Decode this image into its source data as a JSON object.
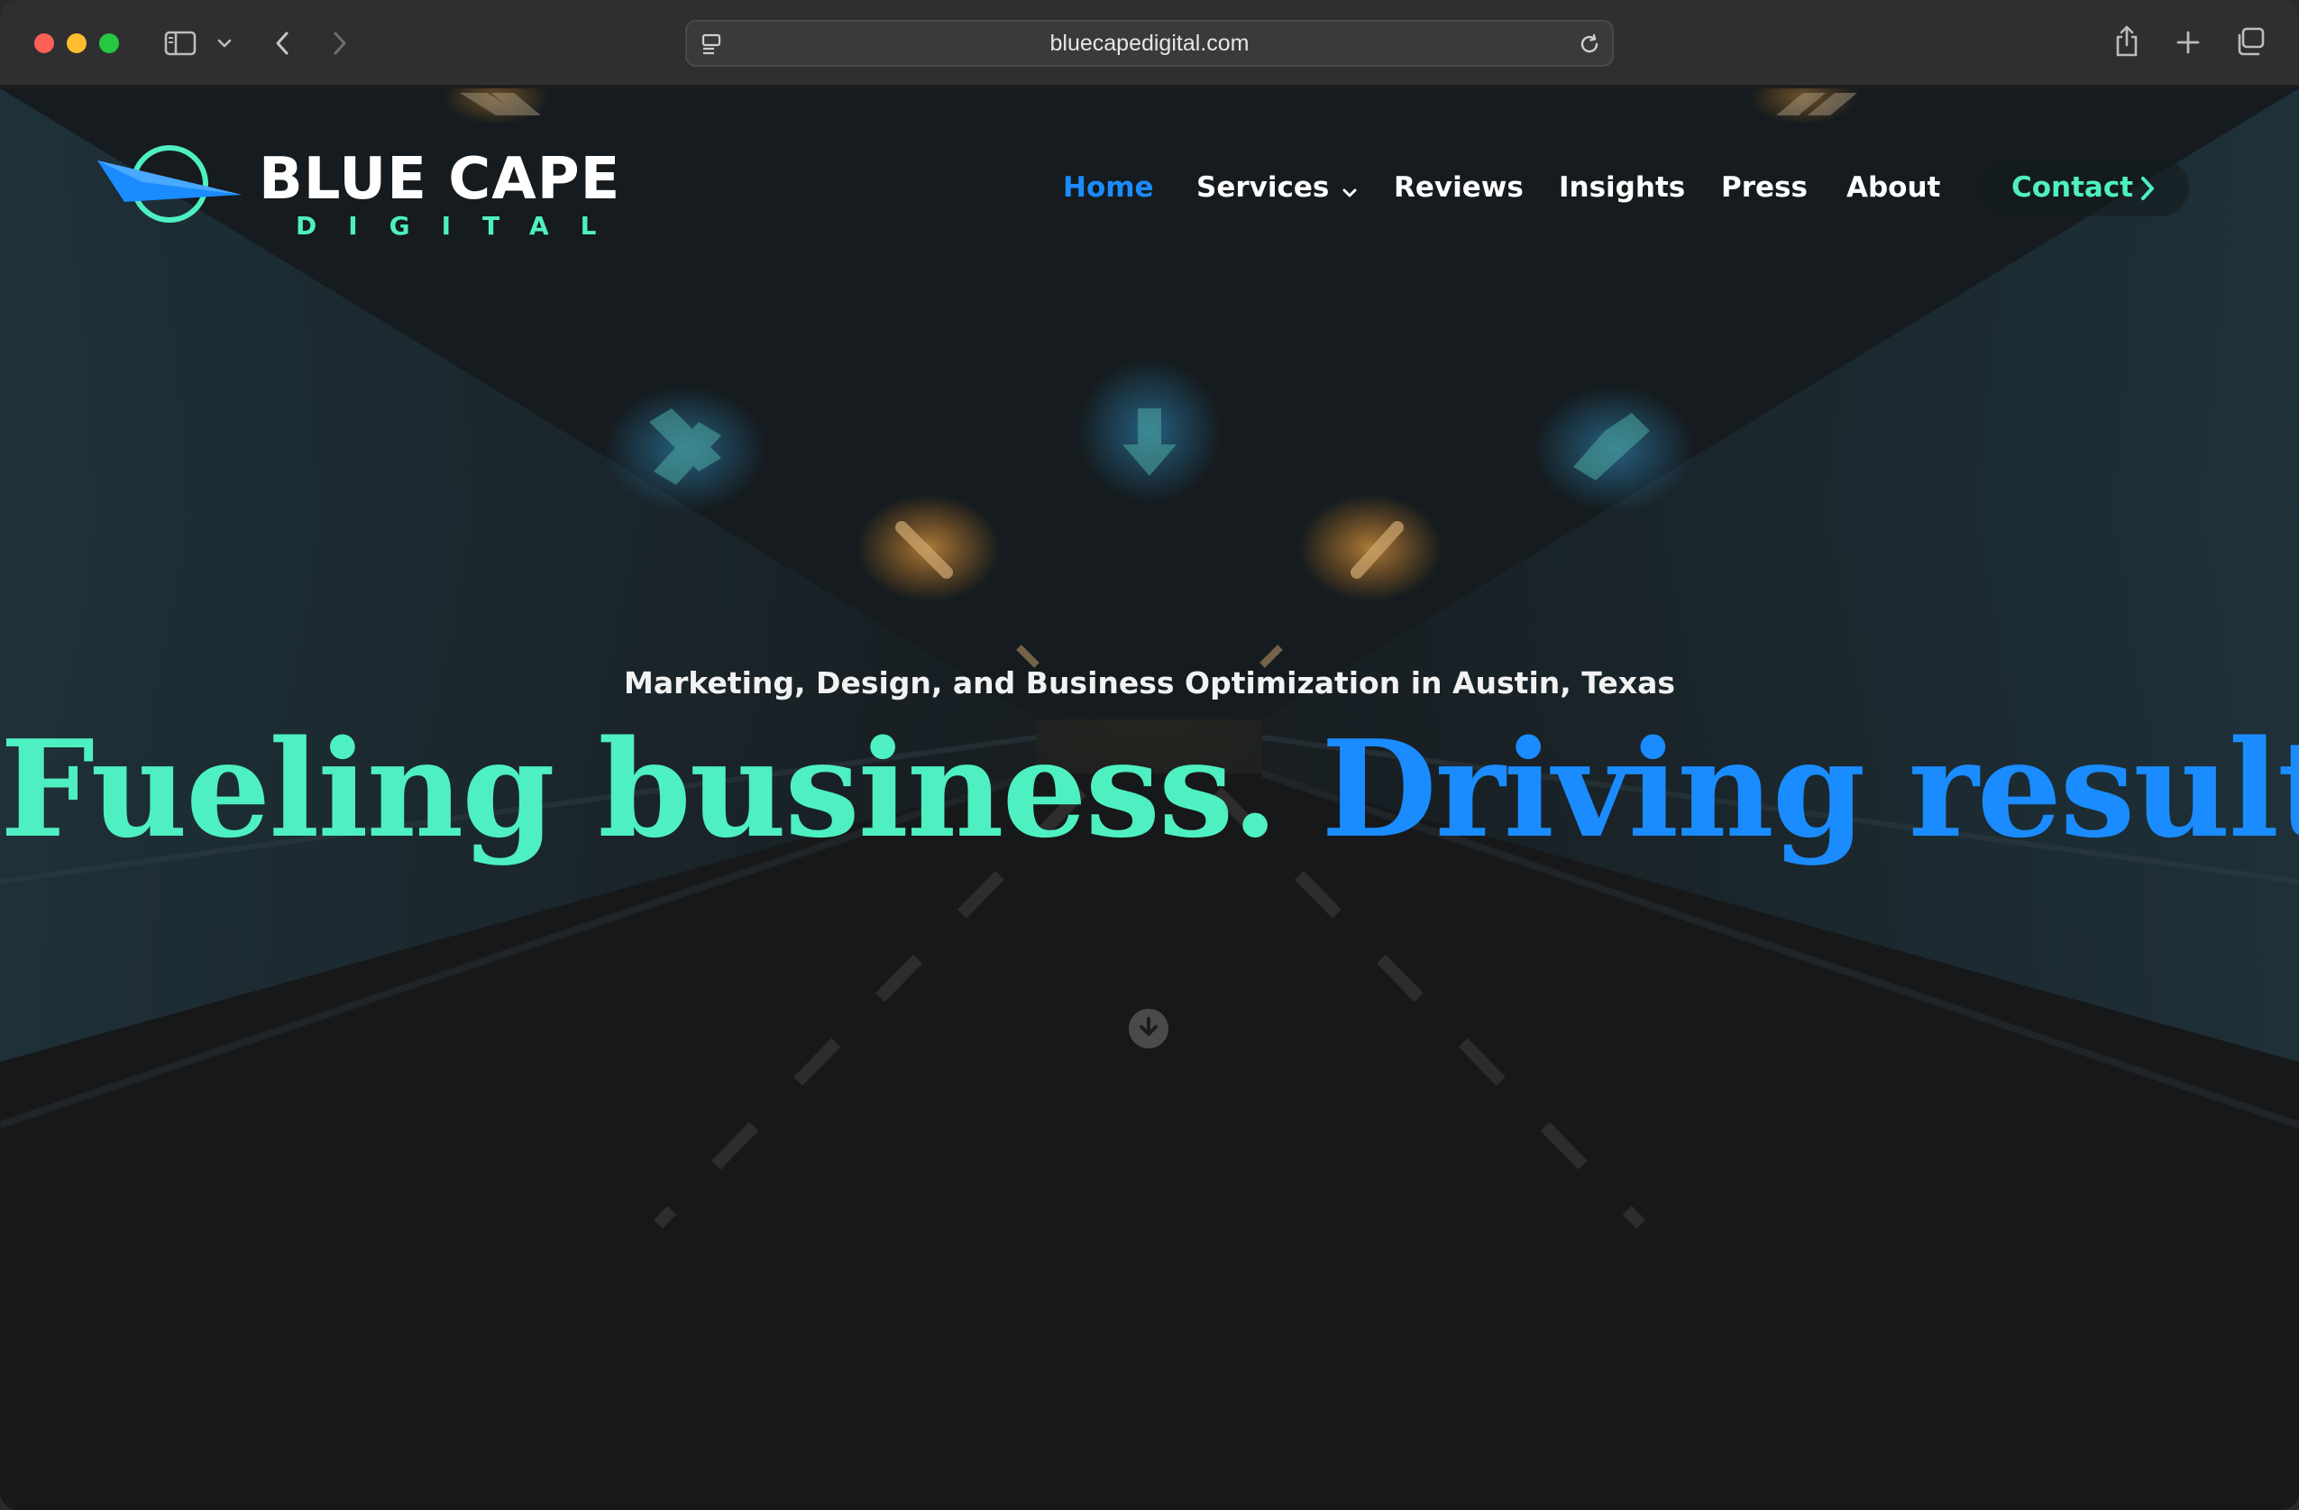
{
  "browser": {
    "url": "bluecapedigital.com",
    "icons": {
      "sidebar": "sidebar-icon",
      "tab_group": "chevron-down-icon",
      "back": "back-arrow-icon",
      "forward": "forward-arrow-icon",
      "page_menu": "page-settings-icon",
      "reload": "reload-icon",
      "share": "share-icon",
      "new_tab": "plus-icon",
      "tab_overview": "tabs-overview-icon"
    }
  },
  "site": {
    "logo": {
      "title": "BLUE CAPE",
      "subtitle": "DIGITAL"
    },
    "nav": {
      "items": [
        {
          "label": "Home",
          "active": true
        },
        {
          "label": "Services",
          "has_dropdown": true
        },
        {
          "label": "Reviews"
        },
        {
          "label": "Insights"
        },
        {
          "label": "Press"
        },
        {
          "label": "About"
        }
      ],
      "contact": {
        "label": "Contact"
      }
    },
    "hero": {
      "subtitle": "Marketing, Design, and Business Optimization in Austin, Texas",
      "title_part1": "Fueling business.",
      "title_part2": "Driving results."
    },
    "colors": {
      "accent_green": "#4ef0c1",
      "accent_blue": "#1a8cff"
    }
  }
}
